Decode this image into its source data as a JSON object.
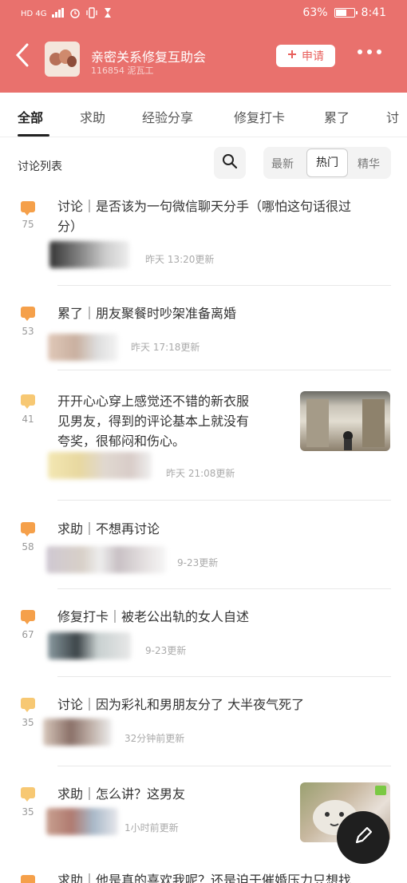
{
  "status_bar": {
    "left_text": "HD 4G",
    "battery_pct": "63%",
    "battery_level": 0.63,
    "time": "8:41"
  },
  "header": {
    "group_name": "亲密关系修复互助会",
    "group_sub": "116854 泥瓦工",
    "apply_label": "申请",
    "bg_color": "#e9716d"
  },
  "tabs": [
    "全部",
    "求助",
    "经验分享",
    "修复打卡",
    "累了",
    "讨"
  ],
  "list": {
    "title": "讨论列表",
    "sort_options": [
      "最新",
      "热门",
      "精华"
    ],
    "active_sort": "热门"
  },
  "posts": [
    {
      "count": "75",
      "title_line1": "讨论｜是否该为一句微信聊天分手（哪怕这句话很过",
      "title_line2": "分）",
      "time": "昨天 13:20更新"
    },
    {
      "count": "53",
      "title_line1": "累了｜朋友聚餐时吵架准备离婚",
      "title_line2": "",
      "time": "昨天 17:18更新"
    },
    {
      "count": "41",
      "title_line1": "开开心心穿上感觉还不错的新衣服",
      "title_line2": "见男友，得到的评论基本上就没有",
      "title_line3": "夸奖，很郁闷和伤心。",
      "time": "昨天 21:08更新"
    },
    {
      "count": "58",
      "title_line1": "求助｜不想再讨论",
      "title_line2": "",
      "time": "9-23更新"
    },
    {
      "count": "67",
      "title_line1": "修复打卡｜被老公出轨的女人自述",
      "title_line2": "",
      "time": "9-23更新"
    },
    {
      "count": "35",
      "title_line1": "讨论｜因为彩礼和男朋友分了 大半夜气死了",
      "title_line2": "",
      "time": "32分钟前更新"
    },
    {
      "count": "35",
      "title_line1": "求助｜怎么讲？这男友",
      "title_line2": "",
      "time": "1小时前更新"
    },
    {
      "count": "",
      "title_line1": "求助｜他是真的喜欢我呢？还是迫于催婚压力只想找",
      "title_line2": "",
      "time": ""
    }
  ],
  "accent_colors": {
    "bubble": "#f5a04a",
    "bubble_pale": "#f7c873",
    "apply_text": "#e8605c"
  },
  "icons": [
    "back-arrow-icon",
    "plus-icon",
    "more-dots-icon",
    "search-icon",
    "comment-bubble-icon",
    "pen-icon"
  ]
}
